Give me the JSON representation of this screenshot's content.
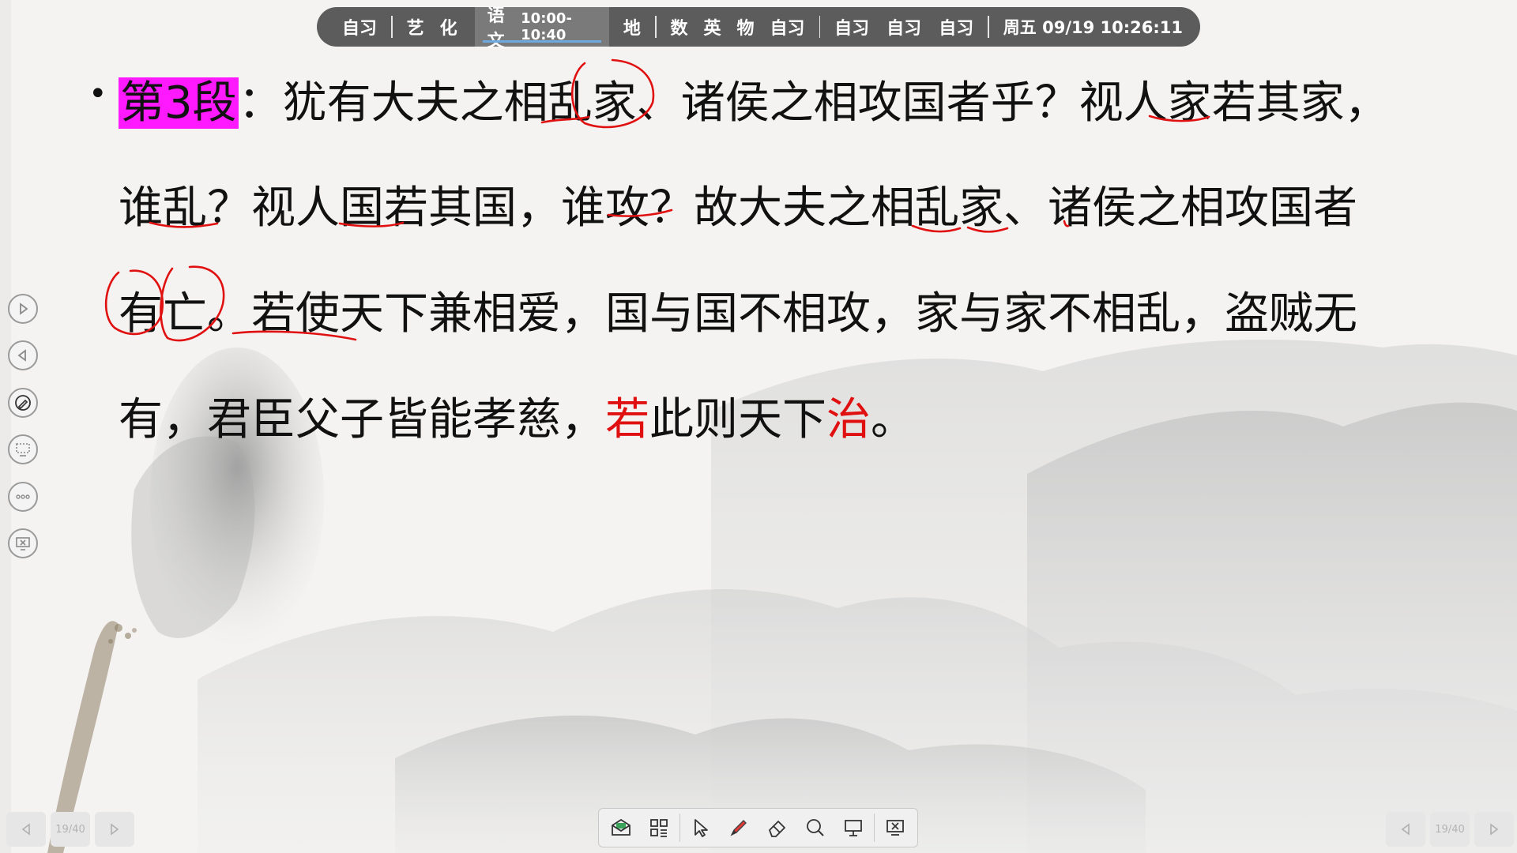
{
  "schedule": {
    "items_1": [
      "自习"
    ],
    "items_2": [
      "艺",
      "化"
    ],
    "current_subject": "语文",
    "current_time": "10:00-10:40",
    "items_3": [
      "地"
    ],
    "items_4": [
      "数",
      "英",
      "物",
      "自习"
    ],
    "items_5": [
      "自习",
      "自习",
      "自习"
    ],
    "clock": "周五 09/19  10:26:11"
  },
  "slide": {
    "bullet": "•",
    "line1_label": "第3段",
    "line1_text": "：犹有大夫之相乱家、诸侯之相攻国者乎？视人家若其家，",
    "line2_text": "谁乱？视人国若其国，谁攻？故大夫之相乱家、诸侯之相攻国者",
    "line3_text": "有亡。若使天下兼相爱，国与国不相攻，家与家不相乱，盗贼无",
    "line4_part1": "有，君臣父子皆能孝慈，",
    "line4_red1": "若",
    "line4_part2": "此则天下",
    "line4_red2": "治",
    "line4_part3": "。"
  },
  "pager": {
    "left_page": "19/40",
    "right_page": "19/40"
  },
  "toolbar": {
    "icons": [
      "whiteboard-icon",
      "apps-grid-icon",
      "select-cursor-icon",
      "pen-icon",
      "eraser-icon",
      "search-icon",
      "presentation-icon",
      "exit-presentation-icon"
    ]
  },
  "colors": {
    "highlight": "#ff19ff",
    "annotation_red": "#e01010",
    "schedule_bar": "#5c5c5c"
  }
}
